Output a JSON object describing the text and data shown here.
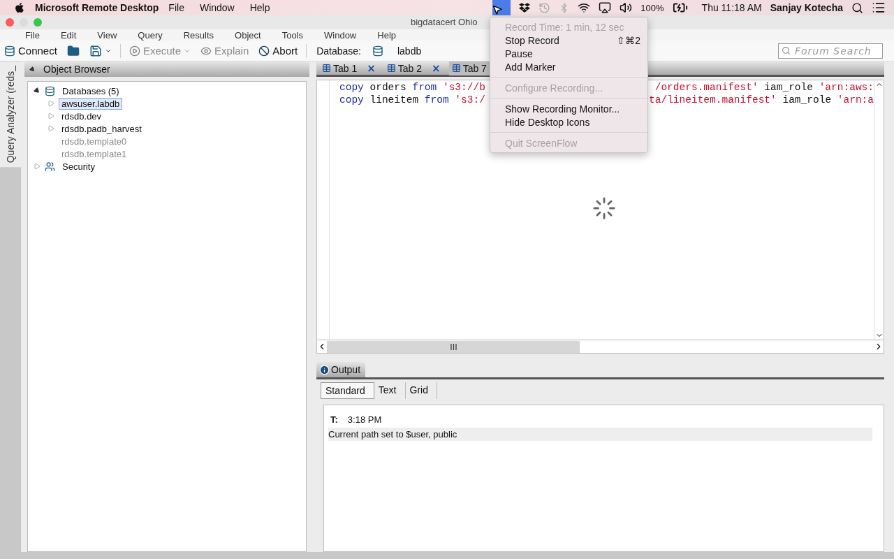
{
  "menu_bar": {
    "app_name": "Microsoft Remote Desktop",
    "menus": [
      "File",
      "Window",
      "Help"
    ],
    "battery": "100%",
    "clock": "Thu 11:18 AM",
    "user": "Sanjay Kotecha"
  },
  "window": {
    "title": "bigdatacert Ohio",
    "menus": [
      "File",
      "Edit",
      "View",
      "Query",
      "Results",
      "Object",
      "Tools",
      "Window",
      "Help"
    ]
  },
  "toolbar": {
    "items": [
      {
        "kind": "connect",
        "label": "Connect",
        "disabled": false
      },
      {
        "kind": "open"
      },
      {
        "kind": "save"
      },
      {
        "kind": "execute",
        "label": "Execute",
        "disabled": true
      },
      {
        "kind": "explain",
        "label": "Explain",
        "disabled": true
      },
      {
        "kind": "abort",
        "label": "Abort",
        "disabled": false
      }
    ],
    "database_label": "Database:",
    "database": "labdb",
    "search": {
      "placeholder": "Forum Search"
    }
  },
  "side_tab": "Query Analyzer (reds_",
  "object_browser": {
    "title": "Object Browser",
    "tree": [
      {
        "kind": "databases",
        "label": "Databases (5)",
        "expanded": true,
        "children": [
          {
            "label": "awsuser.labdb",
            "selected": true,
            "expandable": true,
            "disabled": false
          },
          {
            "label": "rdsdb.dev",
            "selected": false,
            "expandable": true,
            "disabled": false
          },
          {
            "label": "rdsdb.padb_harvest",
            "selected": false,
            "expandable": true,
            "disabled": false
          },
          {
            "label": "rdsdb.template0",
            "selected": false,
            "expandable": false,
            "disabled": true
          },
          {
            "label": "rdsdb.template1",
            "selected": false,
            "expandable": false,
            "disabled": true
          }
        ]
      },
      {
        "kind": "security",
        "label": "Security",
        "expanded": false
      }
    ]
  },
  "editor": {
    "tabs": [
      {
        "label": "Tab 1",
        "selected": false,
        "close": "×"
      },
      {
        "label": "Tab 2",
        "selected": false,
        "close": "×"
      },
      {
        "label": "Tab 7",
        "selected": true
      }
    ],
    "lines": [
      {
        "left": [
          {
            "kind": "keyword",
            "text": "copy"
          },
          {
            "kind": "plain",
            "text": " orders "
          },
          {
            "kind": "keyword",
            "text": "from"
          },
          {
            "kind": "string",
            "text": " 's3://b"
          }
        ],
        "right": [
          {
            "kind": "string",
            "text": "/orders.manifest'"
          },
          {
            "kind": "plain",
            "text": " iam_role "
          },
          {
            "kind": "string",
            "text": "'arn:aws:"
          }
        ]
      },
      {
        "left": [
          {
            "kind": "keyword",
            "text": "copy"
          },
          {
            "kind": "plain",
            "text": " lineitem "
          },
          {
            "kind": "keyword",
            "text": "from"
          },
          {
            "kind": "string",
            "text": " 's3:/"
          }
        ],
        "right": [
          {
            "kind": "string",
            "text": "ta/lineitem.manifest'"
          },
          {
            "kind": "plain",
            "text": " iam_role "
          },
          {
            "kind": "string",
            "text": "'arn:a"
          }
        ]
      }
    ],
    "loading": true
  },
  "output": {
    "title": "Output",
    "tabs": [
      {
        "label": "Standard",
        "selected": true
      },
      {
        "label": "Text",
        "selected": false
      },
      {
        "label": "Grid",
        "selected": false
      }
    ],
    "time_label": "T:",
    "time": "3:18 PM",
    "messages": [
      "Current path set to $user, public"
    ]
  },
  "recording_menu": {
    "groups": [
      [
        {
          "label": "Record Time: 1 min, 12 sec",
          "disabled": true
        },
        {
          "label": "Stop Record",
          "shortcut": "⇧⌘2",
          "disabled": false
        },
        {
          "label": "Pause",
          "disabled": false
        },
        {
          "label": "Add Marker",
          "disabled": false
        }
      ],
      [
        {
          "label": "Configure Recording...",
          "disabled": true
        }
      ],
      [
        {
          "label": "Show Recording Monitor...",
          "disabled": false
        },
        {
          "label": "Hide Desktop Icons",
          "disabled": false
        }
      ],
      [
        {
          "label": "Quit ScreenFlow",
          "disabled": true
        }
      ]
    ]
  }
}
